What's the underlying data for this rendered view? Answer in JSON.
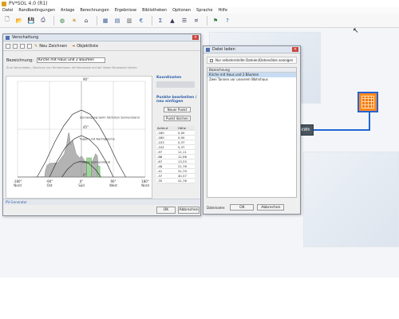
{
  "app": {
    "title": "PV*SOL 4.0 (R1)"
  },
  "menu": [
    "Datei",
    "Randbedingungen",
    "Anlage",
    "Berechnungen",
    "Ergebnisse",
    "Bibliotheken",
    "Optionen",
    "Sprache",
    "Hilfe"
  ],
  "toolbar_icons": [
    "new-file-icon",
    "open-folder-icon",
    "save-icon",
    "print-icon",
    "globe-icon",
    "weather-data-icon",
    "load-profile-icon",
    "pv-array-icon",
    "module-library-icon",
    "inverter-icon",
    "euro-icon",
    "sum-icon",
    "calculation-chart-icon",
    "report-icon",
    "tariff-icon",
    "shading-icon",
    "help-icon",
    "info-icon"
  ],
  "desktop": {
    "meter_label": "kWh"
  },
  "shading_window": {
    "title": "Verschattung",
    "new_drawing_label": "Neu Zeichnen",
    "object_list_label": "Objektliste",
    "description_label": "Bezeichnung:",
    "description_value": "Kirche mit Haus und 2 Bäumen",
    "hint_text": "Zum Verschieben, Zeichnen von Hindernissen die Maustaste auf der linken Maustaste klicken",
    "coordinates_title": "Koordinaten",
    "points_title": "Punkte bearbeiten / neu einfügen",
    "new_point_btn": "Neuer Punkt",
    "delete_point_btn": "Punkt löschen",
    "table_headers": [
      "Azimut",
      "Höhe"
    ],
    "table_rows": [
      [
        "-180",
        "0,00"
      ],
      [
        "-180",
        "0,00"
      ],
      [
        "-103",
        "0,37"
      ],
      [
        "-102",
        "5,37"
      ],
      [
        "-97",
        "11,11"
      ],
      [
        "-88",
        "12,96"
      ],
      [
        "-67",
        "13,33"
      ],
      [
        "-48",
        "21,76"
      ],
      [
        "-41",
        "31,79"
      ],
      [
        "-37",
        "40,37"
      ],
      [
        "-35",
        "41,76"
      ]
    ],
    "status_text": "PV-Generator",
    "ok_btn": "OK",
    "cancel_btn": "Abbrechen"
  },
  "load_window": {
    "title": "Datei laden",
    "checkbox_label": "Nur selbsterstellte Dateien/Datensätze anzeigen",
    "list_header": "Bezeichnung",
    "rows": [
      "Kirche mit Haus und 2 Bäumen",
      "Zwei Tannen vor unserem Wohnhaus"
    ],
    "selected_index": 0,
    "footer_label": "Dateiname:",
    "ok_btn": "OK",
    "cancel_btn": "Abbrechen"
  },
  "chart_data": {
    "type": "area",
    "x_ticks": [
      "-180°",
      "-90°",
      "0°",
      "90°",
      "180°"
    ],
    "x_tick_names": [
      "Nord",
      "Ost",
      "Süd",
      "West",
      "Nord"
    ],
    "y_ticks": [
      "0°",
      "45°",
      "90°"
    ],
    "xlim": [
      -180,
      180
    ],
    "ylim": [
      0,
      90
    ],
    "annotations": [
      "Sonnengang beim höchsten Sonnenstand",
      "Tages- und Nachtgleiche",
      "Tiefster Sonnenstand"
    ],
    "sun_paths": [
      {
        "name": "Sonnengang beim höchsten Sonnenstand",
        "x": [
          -125,
          -100,
          -75,
          -50,
          -25,
          0,
          25,
          50,
          75,
          100,
          125
        ],
        "y": [
          0,
          15,
          33,
          48,
          59,
          63,
          59,
          48,
          33,
          15,
          0
        ]
      },
      {
        "name": "Tages- und Nachtgleiche",
        "x": [
          -90,
          -70,
          -45,
          -20,
          0,
          20,
          45,
          70,
          90
        ],
        "y": [
          0,
          14,
          28,
          36,
          39,
          36,
          28,
          14,
          0
        ]
      },
      {
        "name": "Tiefster Sonnenstand",
        "x": [
          -55,
          -40,
          -20,
          0,
          20,
          40,
          55
        ],
        "y": [
          0,
          7,
          13,
          15,
          13,
          7,
          0
        ]
      }
    ],
    "horizon_outline": {
      "x": [
        -180,
        -103,
        -102,
        -97,
        -88,
        -67,
        -48,
        -41,
        -37,
        -35,
        -30,
        -25,
        -15,
        -5,
        0,
        10,
        20,
        30,
        40,
        45,
        50,
        70,
        90,
        180
      ],
      "y": [
        0,
        0.37,
        5.37,
        11.11,
        12.96,
        13.33,
        21.76,
        31.79,
        40.37,
        41.76,
        30,
        35,
        22,
        18,
        20,
        15,
        14,
        14,
        22,
        20,
        0,
        0,
        0,
        0
      ]
    },
    "tree_patches": [
      {
        "x_start": 15,
        "x_end": 28,
        "height": 18
      },
      {
        "x_start": 45,
        "x_end": 52,
        "height": 10
      }
    ]
  },
  "colors": {
    "accent": "#2862d4",
    "module": "#f27a10",
    "titlebar": "#dfe6ef",
    "highlight": "#c7dcf3"
  }
}
